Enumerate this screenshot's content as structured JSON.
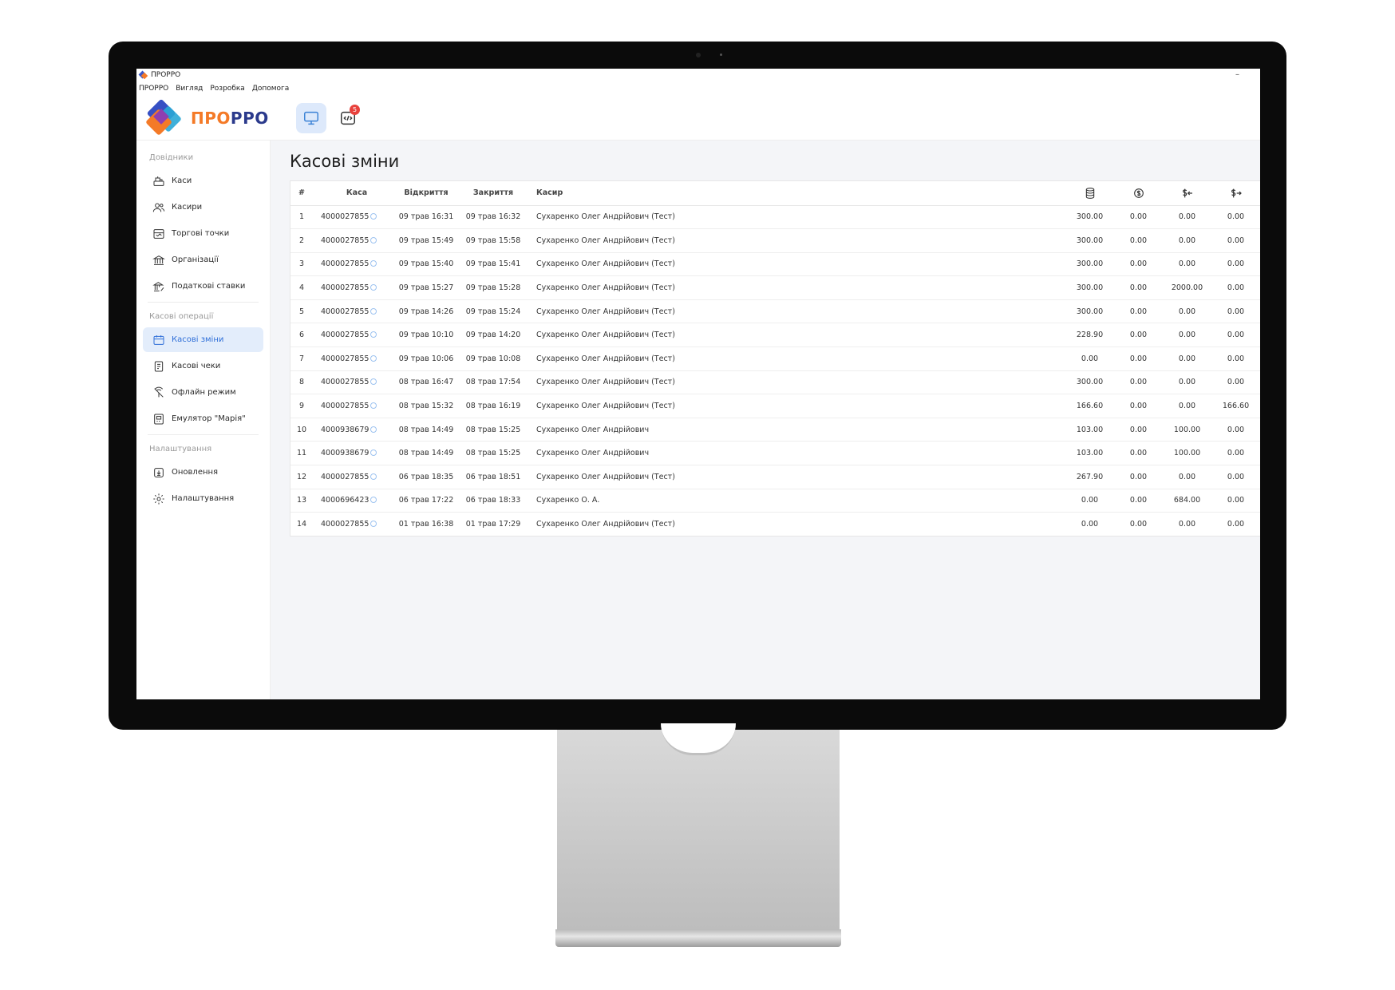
{
  "window": {
    "title": "ПРОРРО",
    "menu": [
      "ПРОРРО",
      "Вигляд",
      "Розробка",
      "Допомога"
    ]
  },
  "header": {
    "logo_part1": "ПРО",
    "logo_part2": "РРО",
    "dev_badge": "5"
  },
  "sidebar": {
    "group_directories": "Довідники",
    "group_operations": "Касові операції",
    "group_settings": "Налаштування",
    "items": [
      {
        "label": "Каси",
        "icon": "cash-register-icon"
      },
      {
        "label": "Касири",
        "icon": "users-icon"
      },
      {
        "label": "Торгові точки",
        "icon": "store-icon"
      },
      {
        "label": "Організації",
        "icon": "bank-icon"
      },
      {
        "label": "Податкові ставки",
        "icon": "tax-icon"
      },
      {
        "label": "Касові зміни",
        "icon": "calendar-icon",
        "active": true
      },
      {
        "label": "Касові чеки",
        "icon": "receipt-icon"
      },
      {
        "label": "Офлайн режим",
        "icon": "offline-icon"
      },
      {
        "label": "Емулятор \"Марія\"",
        "icon": "emulator-icon"
      },
      {
        "label": "Оновлення",
        "icon": "download-icon"
      },
      {
        "label": "Налаштування",
        "icon": "gear-icon"
      }
    ]
  },
  "main": {
    "title": "Касові зміни",
    "columns": {
      "num": "#",
      "kasa": "Каса",
      "open": "Відкриття",
      "close": "Закриття",
      "cashier": "Касир"
    },
    "amount_icons": [
      "coins-stack-icon",
      "cash-return-icon",
      "cash-in-icon",
      "cash-out-icon"
    ],
    "rows": [
      [
        "1",
        "4000027855",
        "09 трав 16:31",
        "09 трав 16:32",
        "Сухаренко Олег Андрійович (Тест)",
        "300.00",
        "0.00",
        "0.00",
        "0.00"
      ],
      [
        "2",
        "4000027855",
        "09 трав 15:49",
        "09 трав 15:58",
        "Сухаренко Олег Андрійович (Тест)",
        "300.00",
        "0.00",
        "0.00",
        "0.00"
      ],
      [
        "3",
        "4000027855",
        "09 трав 15:40",
        "09 трав 15:41",
        "Сухаренко Олег Андрійович (Тест)",
        "300.00",
        "0.00",
        "0.00",
        "0.00"
      ],
      [
        "4",
        "4000027855",
        "09 трав 15:27",
        "09 трав 15:28",
        "Сухаренко Олег Андрійович (Тест)",
        "300.00",
        "0.00",
        "2000.00",
        "0.00"
      ],
      [
        "5",
        "4000027855",
        "09 трав 14:26",
        "09 трав 15:24",
        "Сухаренко Олег Андрійович (Тест)",
        "300.00",
        "0.00",
        "0.00",
        "0.00"
      ],
      [
        "6",
        "4000027855",
        "09 трав 10:10",
        "09 трав 14:20",
        "Сухаренко Олег Андрійович (Тест)",
        "228.90",
        "0.00",
        "0.00",
        "0.00"
      ],
      [
        "7",
        "4000027855",
        "09 трав 10:06",
        "09 трав 10:08",
        "Сухаренко Олег Андрійович (Тест)",
        "0.00",
        "0.00",
        "0.00",
        "0.00"
      ],
      [
        "8",
        "4000027855",
        "08 трав 16:47",
        "08 трав 17:54",
        "Сухаренко Олег Андрійович (Тест)",
        "300.00",
        "0.00",
        "0.00",
        "0.00"
      ],
      [
        "9",
        "4000027855",
        "08 трав 15:32",
        "08 трав 16:19",
        "Сухаренко Олег Андрійович (Тест)",
        "166.60",
        "0.00",
        "0.00",
        "166.60"
      ],
      [
        "10",
        "4000938679",
        "08 трав 14:49",
        "08 трав 15:25",
        "Сухаренко Олег Андрійович",
        "103.00",
        "0.00",
        "100.00",
        "0.00"
      ],
      [
        "11",
        "4000938679",
        "08 трав 14:49",
        "08 трав 15:25",
        "Сухаренко Олег Андрійович",
        "103.00",
        "0.00",
        "100.00",
        "0.00"
      ],
      [
        "12",
        "4000027855",
        "06 трав 18:35",
        "06 трав 18:51",
        "Сухаренко Олег Андрійович (Тест)",
        "267.90",
        "0.00",
        "0.00",
        "0.00"
      ],
      [
        "13",
        "4000696423",
        "06 трав 17:22",
        "06 трав 18:33",
        "Сухаренко О. А.",
        "0.00",
        "0.00",
        "684.00",
        "0.00"
      ],
      [
        "14",
        "4000027855",
        "01 трав 16:38",
        "01 трав 17:29",
        "Сухаренко Олег Андрійович (Тест)",
        "0.00",
        "0.00",
        "0.00",
        "0.00"
      ]
    ]
  },
  "colors": {
    "accent": "#2f6fd8",
    "active_bg": "#e3edfb",
    "badge": "#e8413c",
    "logo_orange": "#f47a27",
    "logo_navy": "#2b3a8c"
  }
}
